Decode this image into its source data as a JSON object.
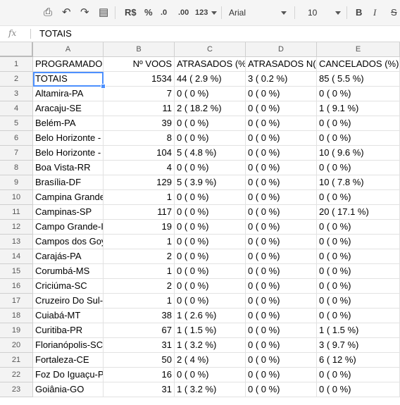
{
  "toolbar": {
    "currency": "R$",
    "percent": "%",
    "dec_less": ".0",
    "dec_more": ".00",
    "more_formats": "123",
    "font": "Arial",
    "font_size": "10",
    "bold": "B",
    "italic": "I",
    "strike": "S"
  },
  "formula_bar": {
    "fx_label": "fx",
    "value": "TOTAIS"
  },
  "columns": [
    "A",
    "B",
    "C",
    "D",
    "E"
  ],
  "rows": [
    {
      "n": "1",
      "a": "PROGRAMADO",
      "b": "Nº VOOS",
      "c": "ATRASADOS (%",
      "d": "ATRASADOS N(",
      "e": "CANCELADOS (%)"
    },
    {
      "n": "2",
      "a": "TOTAIS",
      "b": "1534",
      "c": "44 ( 2.9 %)",
      "d": "3 ( 0.2 %)",
      "e": "85 ( 5.5 %)"
    },
    {
      "n": "3",
      "a": "Altamira-PA",
      "b": "7",
      "c": "0 ( 0 %)",
      "d": "0 ( 0 %)",
      "e": "0 ( 0 %)"
    },
    {
      "n": "4",
      "a": "Aracaju-SE",
      "b": "11",
      "c": "2 ( 18.2 %)",
      "d": "0 ( 0 %)",
      "e": "1 ( 9.1 %)"
    },
    {
      "n": "5",
      "a": "Belém-PA",
      "b": "39",
      "c": "0 ( 0 %)",
      "d": "0 ( 0 %)",
      "e": "0 ( 0 %)"
    },
    {
      "n": "6",
      "a": "Belo Horizonte -",
      "b": "8",
      "c": "0 ( 0 %)",
      "d": "0 ( 0 %)",
      "e": "0 ( 0 %)"
    },
    {
      "n": "7",
      "a": "Belo Horizonte -",
      "b": "104",
      "c": "5 ( 4.8 %)",
      "d": "0 ( 0 %)",
      "e": "10 ( 9.6 %)"
    },
    {
      "n": "8",
      "a": "Boa Vista-RR",
      "b": "4",
      "c": "0 ( 0 %)",
      "d": "0 ( 0 %)",
      "e": "0 ( 0 %)"
    },
    {
      "n": "9",
      "a": "Brasília-DF",
      "b": "129",
      "c": "5 ( 3.9 %)",
      "d": "0 ( 0 %)",
      "e": "10 ( 7.8 %)"
    },
    {
      "n": "10",
      "a": "Campina Grande",
      "b": "1",
      "c": "0 ( 0 %)",
      "d": "0 ( 0 %)",
      "e": "0 ( 0 %)"
    },
    {
      "n": "11",
      "a": "Campinas-SP",
      "b": "117",
      "c": "0 ( 0 %)",
      "d": "0 ( 0 %)",
      "e": "20 ( 17.1 %)"
    },
    {
      "n": "12",
      "a": "Campo Grande-I",
      "b": "19",
      "c": "0 ( 0 %)",
      "d": "0 ( 0 %)",
      "e": "0 ( 0 %)"
    },
    {
      "n": "13",
      "a": "Campos dos Goy",
      "b": "1",
      "c": "0 ( 0 %)",
      "d": "0 ( 0 %)",
      "e": "0 ( 0 %)"
    },
    {
      "n": "14",
      "a": "Carajás-PA",
      "b": "2",
      "c": "0 ( 0 %)",
      "d": "0 ( 0 %)",
      "e": "0 ( 0 %)"
    },
    {
      "n": "15",
      "a": "Corumbá-MS",
      "b": "1",
      "c": "0 ( 0 %)",
      "d": "0 ( 0 %)",
      "e": "0 ( 0 %)"
    },
    {
      "n": "16",
      "a": "Criciúma-SC",
      "b": "2",
      "c": "0 ( 0 %)",
      "d": "0 ( 0 %)",
      "e": "0 ( 0 %)"
    },
    {
      "n": "17",
      "a": "Cruzeiro Do Sul-",
      "b": "1",
      "c": "0 ( 0 %)",
      "d": "0 ( 0 %)",
      "e": "0 ( 0 %)"
    },
    {
      "n": "18",
      "a": "Cuiabá-MT",
      "b": "38",
      "c": "1 ( 2.6 %)",
      "d": "0 ( 0 %)",
      "e": "0 ( 0 %)"
    },
    {
      "n": "19",
      "a": "Curitiba-PR",
      "b": "67",
      "c": "1 ( 1.5 %)",
      "d": "0 ( 0 %)",
      "e": "1 ( 1.5 %)"
    },
    {
      "n": "20",
      "a": "Florianópolis-SC",
      "b": "31",
      "c": "1 ( 3.2 %)",
      "d": "0 ( 0 %)",
      "e": "3 ( 9.7 %)"
    },
    {
      "n": "21",
      "a": "Fortaleza-CE",
      "b": "50",
      "c": "2 ( 4 %)",
      "d": "0 ( 0 %)",
      "e": "6 ( 12 %)"
    },
    {
      "n": "22",
      "a": "Foz Do Iguaçu-P",
      "b": "16",
      "c": "0 ( 0 %)",
      "d": "0 ( 0 %)",
      "e": "0 ( 0 %)"
    },
    {
      "n": "23",
      "a": "Goiânia-GO",
      "b": "31",
      "c": "1 ( 3.2 %)",
      "d": "0 ( 0 %)",
      "e": "0 ( 0 %)"
    }
  ],
  "selected_cell": "A2",
  "colors": {
    "selection": "#4d90fe",
    "header_bg": "#f3f3f3",
    "toolbar_bg": "#f5f5f5"
  }
}
